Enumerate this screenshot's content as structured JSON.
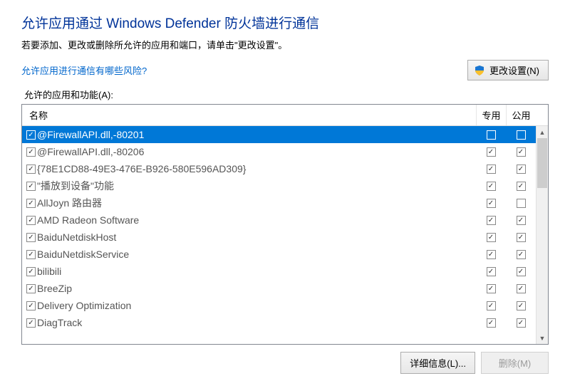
{
  "heading": "允许应用通过 Windows Defender 防火墙进行通信",
  "subtext": "若要添加、更改或删除所允许的应用和端口，请单击\"更改设置\"。",
  "risk_link": "允许应用进行通信有哪些风险?",
  "change_settings_btn": "更改设置(N)",
  "section_label": "允许的应用和功能(A):",
  "columns": {
    "name": "名称",
    "private": "专用",
    "public": "公用"
  },
  "rows": [
    {
      "name": "@FirewallAPI.dll,-80201",
      "enabled": true,
      "private": false,
      "public": false,
      "selected": true
    },
    {
      "name": "@FirewallAPI.dll,-80206",
      "enabled": true,
      "private": true,
      "public": true,
      "selected": false
    },
    {
      "name": "{78E1CD88-49E3-476E-B926-580E596AD309}",
      "enabled": true,
      "private": true,
      "public": true,
      "selected": false
    },
    {
      "name": "\"播放到设备\"功能",
      "enabled": true,
      "private": true,
      "public": true,
      "selected": false
    },
    {
      "name": "AllJoyn 路由器",
      "enabled": true,
      "private": true,
      "public": false,
      "selected": false
    },
    {
      "name": "AMD Radeon Software",
      "enabled": true,
      "private": true,
      "public": true,
      "selected": false
    },
    {
      "name": "BaiduNetdiskHost",
      "enabled": true,
      "private": true,
      "public": true,
      "selected": false
    },
    {
      "name": "BaiduNetdiskService",
      "enabled": true,
      "private": true,
      "public": true,
      "selected": false
    },
    {
      "name": "bilibili",
      "enabled": true,
      "private": true,
      "public": true,
      "selected": false
    },
    {
      "name": "BreeZip",
      "enabled": true,
      "private": true,
      "public": true,
      "selected": false
    },
    {
      "name": "Delivery Optimization",
      "enabled": true,
      "private": true,
      "public": true,
      "selected": false
    },
    {
      "name": "DiagTrack",
      "enabled": true,
      "private": true,
      "public": true,
      "selected": false
    }
  ],
  "details_btn": "详细信息(L)...",
  "remove_btn": "删除(M)"
}
